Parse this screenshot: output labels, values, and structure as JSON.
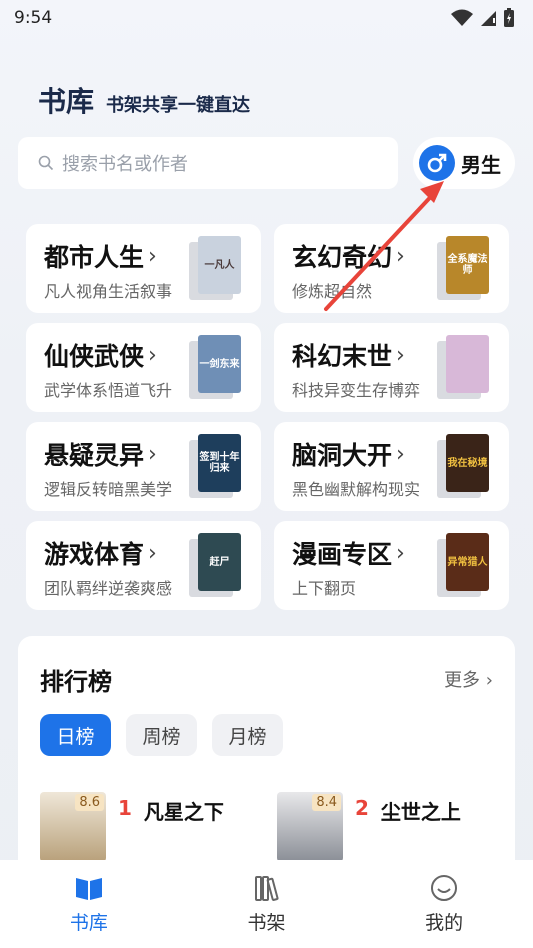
{
  "status": {
    "time": "9:54"
  },
  "header": {
    "title": "书库",
    "subtitle": "书架共享一键直达"
  },
  "search": {
    "placeholder": "搜索书名或作者"
  },
  "gender": {
    "label": "男生"
  },
  "categories": [
    {
      "title": "都市人生",
      "desc": "凡人视角生活叙事",
      "cover_text": "一凡人",
      "cover_color": "#c9d2de"
    },
    {
      "title": "玄幻奇幻",
      "desc": "修炼超自然",
      "cover_text": "全系魔法师",
      "cover_color": "#b8872a"
    },
    {
      "title": "仙侠武侠",
      "desc": "武学体系悟道飞升",
      "cover_text": "一剑东来",
      "cover_color": "#6f8fb6"
    },
    {
      "title": "科幻末世",
      "desc": "科技异变生存博弈",
      "cover_text": "",
      "cover_color": "#d8b8d8"
    },
    {
      "title": "悬疑灵异",
      "desc": "逻辑反转暗黑美学",
      "cover_text": "签到十年归来",
      "cover_color": "#1e3e5c"
    },
    {
      "title": "脑洞大开",
      "desc": "黑色幽默解构现实",
      "cover_text": "我在秘境",
      "cover_color": "#3a2418"
    },
    {
      "title": "游戏体育",
      "desc": "团队羁绊逆袭爽感",
      "cover_text": "赶尸",
      "cover_color": "#2e4a52"
    },
    {
      "title": "漫画专区",
      "desc": "上下翻页",
      "cover_text": "异常猎人",
      "cover_color": "#5a2c18"
    }
  ],
  "ranking": {
    "title": "排行榜",
    "more": "更多",
    "tabs": [
      "日榜",
      "周榜",
      "月榜"
    ],
    "active_tab": "日榜",
    "items": [
      {
        "rank": "1",
        "name": "凡星之下",
        "score": "8.6"
      },
      {
        "rank": "2",
        "name": "尘世之上",
        "score": "8.4"
      }
    ]
  },
  "tabbar": {
    "items": [
      "书库",
      "书架",
      "我的"
    ],
    "active": "书库"
  },
  "colors": {
    "accent": "#1e73e8",
    "rank_number": "#e8443a"
  }
}
